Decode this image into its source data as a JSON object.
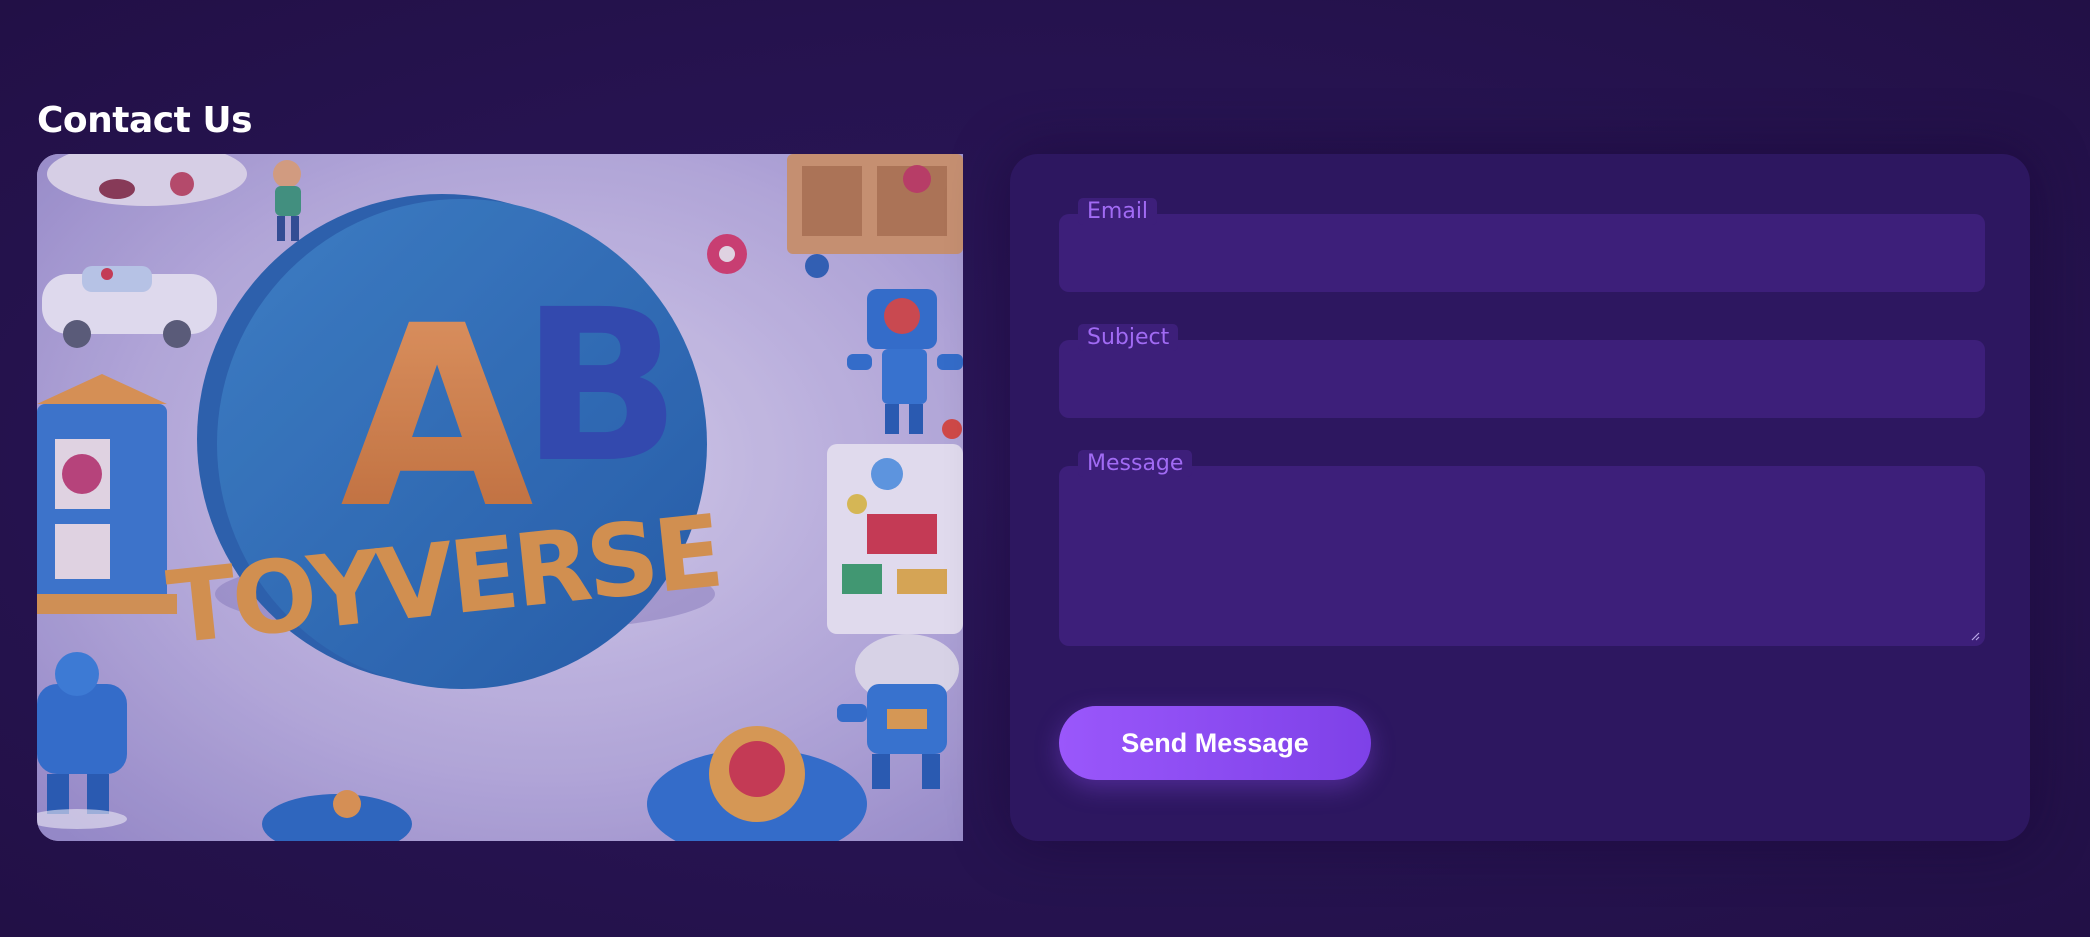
{
  "page": {
    "title": "Contact Us"
  },
  "hero_image": {
    "alt": "AB TOYVERSE",
    "logo_text_top": "AB",
    "logo_text_bottom": "TOYVERSE"
  },
  "form": {
    "email": {
      "label": "Email",
      "value": "",
      "placeholder": ""
    },
    "subject": {
      "label": "Subject",
      "value": "",
      "placeholder": ""
    },
    "message": {
      "label": "Message",
      "value": "",
      "placeholder": ""
    },
    "submit_label": "Send Message"
  },
  "colors": {
    "background": "#271451",
    "card": "#2d1760",
    "field": "#3d1f7a",
    "label": "#a16bf4",
    "button_start": "#9a57fb",
    "button_end": "#7e41e8"
  }
}
